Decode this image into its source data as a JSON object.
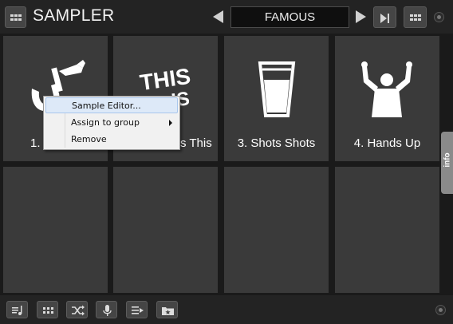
{
  "header": {
    "title": "SAMPLER",
    "bank_name": "FAMOUS"
  },
  "pads": [
    {
      "label": "1. Sax",
      "icon": "saxophone-icon"
    },
    {
      "label": "2. This Is This",
      "icon": "this-is-text-icon"
    },
    {
      "label": "3. Shots Shots",
      "icon": "shot-glass-icon"
    },
    {
      "label": "4. Hands Up",
      "icon": "hands-up-person-icon"
    },
    {
      "label": ""
    },
    {
      "label": ""
    },
    {
      "label": ""
    },
    {
      "label": ""
    }
  ],
  "pad_visible_text": {
    "pad1": "1.",
    "pad2": "s This",
    "pad2_art_top": "THIS",
    "pad2_art_bottom": "IS"
  },
  "context_menu": {
    "items": [
      {
        "label": "Sample Editor...",
        "highlighted": true
      },
      {
        "label": "Assign to group",
        "has_submenu": true
      },
      {
        "label": "Remove"
      }
    ]
  },
  "side_tab": {
    "label": "info"
  },
  "toolbar": {
    "buttons": [
      "music-note-list-icon",
      "pad-grid-icon",
      "shuffle-icon",
      "microphone-icon",
      "list-arrow-icon",
      "folder-star-icon"
    ]
  },
  "colors": {
    "background": "#1a1a1a",
    "pad": "#3a3a3a",
    "menu_highlight": "#dde9f8"
  }
}
